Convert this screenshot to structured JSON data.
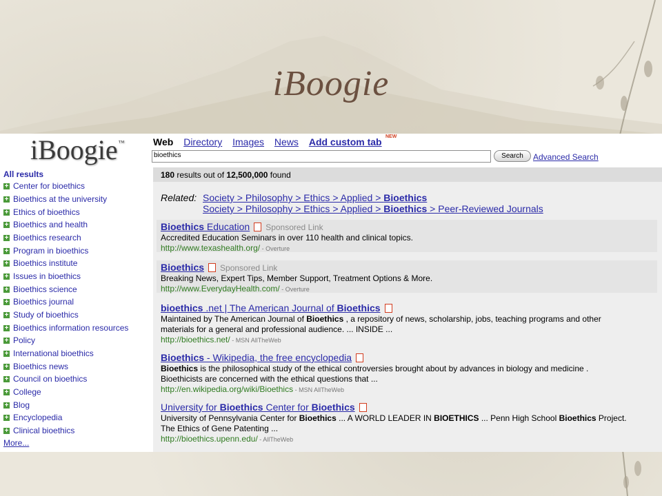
{
  "slide": {
    "title": "iBoogie"
  },
  "app": {
    "logo": "iBoogie",
    "logo_mark": "™"
  },
  "tabs": {
    "web": "Web",
    "directory": "Directory",
    "images": "Images",
    "news": "News",
    "custom": "Add custom tab",
    "new_badge": "NEW"
  },
  "search": {
    "query": "bioethics",
    "button": "Search",
    "advanced": "Advanced Search"
  },
  "results_count": {
    "shown": "180",
    "mid": " results out of ",
    "total": "12,500,000",
    "tail": " found"
  },
  "sidebar": {
    "all_results": "All results",
    "items": [
      "Center for bioethics",
      "Bioethics at the university",
      "Ethics of bioethics",
      "Bioethics and health",
      "Bioethics research",
      "Program in bioethics",
      "Bioethics institute",
      "Issues in bioethics",
      "Bioethics science",
      "Bioethics journal",
      "Study of bioethics",
      "Bioethics information resources",
      "Policy",
      "International bioethics",
      "Bioethics news",
      "Council on bioethics",
      "College",
      "Blog",
      "Encyclopedia",
      "Clinical bioethics"
    ],
    "more": "More..."
  },
  "related": {
    "label": "Related:",
    "path1_prefix": "Society > Philosophy > Ethics > Applied > ",
    "path1_term": "Bioethics",
    "path2_prefix": "Society > Philosophy > Ethics > Applied > ",
    "path2_term": "Bioethics",
    "path2_suffix": " > Peer-Reviewed Journals"
  },
  "results": [
    {
      "title_a": "Bioethics",
      "title_b": " Education",
      "sponsored": "Sponsored Link",
      "desc_line1": "Accredited Education Seminars in over 110 health and clinical topics.",
      "url": "http://www.texashealth.org/",
      "source": " - Overture"
    },
    {
      "title_a": "Bioethics",
      "sponsored": "Sponsored Link",
      "desc_line1": "Breaking News, Expert Tips, Member Support, Treatment Options & More.",
      "url": "http://www.EverydayHealth.com/",
      "source": " - Overture"
    },
    {
      "title_a": "bioethics",
      "title_b": " .net | The American Journal of ",
      "title_c": "Bioethics",
      "desc_line1_a": "Maintained by The American Journal of ",
      "desc_line1_b": "Bioethics",
      "desc_line1_c": " , a repository of news, scholarship, jobs, teaching programs and other",
      "desc_line2": "materials for a general and professional audience. ... INSIDE ...",
      "url": "http://bioethics.net/",
      "source": " - MSN AllTheWeb"
    },
    {
      "title_a": "Bioethics",
      "title_b": " - Wikipedia, the free encyclopedia",
      "desc_line1_a": "Bioethics",
      "desc_line1_b": " is the philosophical study of the ethical controversies brought about by advances in biology and medicine .",
      "desc_line2": "Bioethicists are concerned with the ethical questions that ...",
      "url": "http://en.wikipedia.org/wiki/Bioethics",
      "source": " - MSN AllTheWeb"
    },
    {
      "title_a": "University for ",
      "title_b": "Bioethics",
      "title_c": " Center for ",
      "title_d": "Bioethics",
      "desc_line1_a": "University of Pennsylvania Center for ",
      "desc_line1_b": "Bioethics",
      "desc_line1_c": " ... A WORLD LEADER IN ",
      "desc_line1_d": "BIOETHICS",
      "desc_line1_e": " ... Penn High School ",
      "desc_line1_f": "Bioethics",
      "desc_line1_g": " Project.",
      "desc_line2": "The Ethics of Gene Patenting ...",
      "url": "http://bioethics.upenn.edu/",
      "source": " - AllTheWeb"
    }
  ],
  "colors": {
    "link": "#2a2aa8",
    "url_green": "#2f7a20",
    "title_brown": "#6b5040",
    "plus_green": "#4b9a3a"
  }
}
